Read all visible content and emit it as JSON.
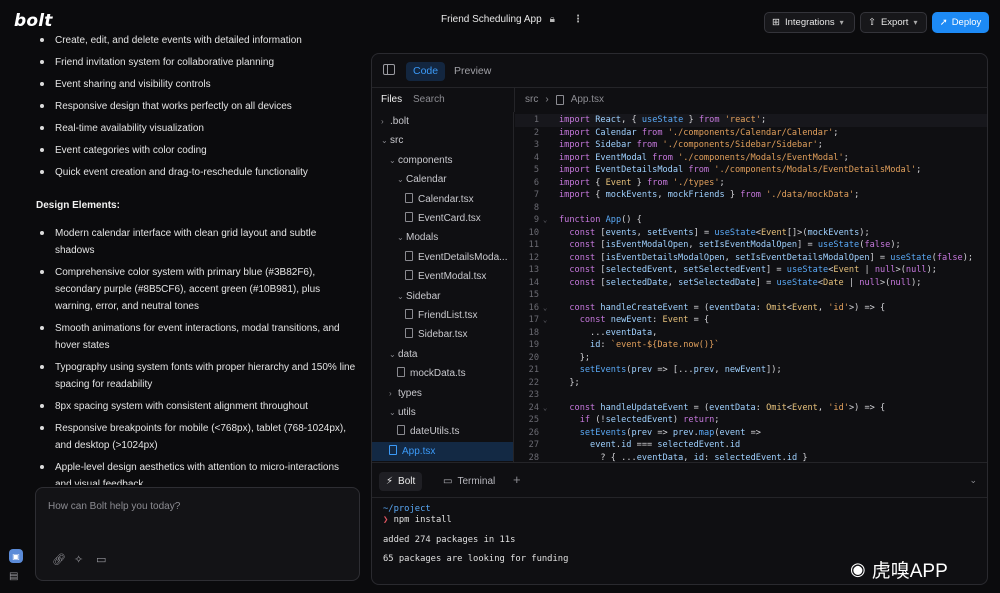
{
  "header": {
    "logo": "bolt",
    "project_title": "Friend Scheduling App",
    "integrations_label": "Integrations",
    "export_label": "Export",
    "deploy_label": "Deploy"
  },
  "chat": {
    "features_partial": [
      "Create, edit, and delete events with detailed information",
      "Friend invitation system for collaborative planning",
      "Event sharing and visibility controls",
      "Responsive design that works perfectly on all devices",
      "Real-time availability visualization",
      "Event categories with color coding",
      "Quick event creation and drag-to-reschedule functionality"
    ],
    "design_heading": "Design Elements:",
    "design_items": [
      "Modern calendar interface with clean grid layout and subtle shadows",
      "Comprehensive color system with primary blue (#3B82F6), secondary purple (#8B5CF6), accent green (#10B981), plus warning, error, and neutral tones",
      "Smooth animations for event interactions, modal transitions, and hover states",
      "Typography using system fonts with proper hierarchy and 150% line spacing for readability",
      "8px spacing system with consistent alignment throughout",
      "Responsive breakpoints for mobile (<768px), tablet (768-1024px), and desktop (>1024px)",
      "Apple-level design aesthetics with attention to micro-interactions and visual feedback"
    ],
    "input_placeholder": "How can Bolt help you today?"
  },
  "workbench": {
    "tabs": {
      "code": "Code",
      "preview": "Preview"
    },
    "files_label": "Files",
    "search_label": "Search",
    "tree": [
      {
        "label": ".bolt",
        "type": "folder",
        "depth": 0,
        "open": false
      },
      {
        "label": "src",
        "type": "folder",
        "depth": 0,
        "open": true
      },
      {
        "label": "components",
        "type": "folder",
        "depth": 1,
        "open": true
      },
      {
        "label": "Calendar",
        "type": "folder",
        "depth": 2,
        "open": true
      },
      {
        "label": "Calendar.tsx",
        "type": "file",
        "depth": 3
      },
      {
        "label": "EventCard.tsx",
        "type": "file",
        "depth": 3
      },
      {
        "label": "Modals",
        "type": "folder",
        "depth": 2,
        "open": true
      },
      {
        "label": "EventDetailsModa...",
        "type": "file",
        "depth": 3
      },
      {
        "label": "EventModal.tsx",
        "type": "file",
        "depth": 3
      },
      {
        "label": "Sidebar",
        "type": "folder",
        "depth": 2,
        "open": true
      },
      {
        "label": "FriendList.tsx",
        "type": "file",
        "depth": 3
      },
      {
        "label": "Sidebar.tsx",
        "type": "file",
        "depth": 3
      },
      {
        "label": "data",
        "type": "folder",
        "depth": 1,
        "open": true
      },
      {
        "label": "mockData.ts",
        "type": "file",
        "depth": 2
      },
      {
        "label": "types",
        "type": "folder",
        "depth": 1,
        "open": false
      },
      {
        "label": "utils",
        "type": "folder",
        "depth": 1,
        "open": true
      },
      {
        "label": "dateUtils.ts",
        "type": "file",
        "depth": 2
      },
      {
        "label": "App.tsx",
        "type": "file",
        "depth": 1,
        "active": true
      }
    ],
    "breadcrumb": {
      "folder": "src",
      "file": "App.tsx"
    },
    "code_lines": [
      {
        "n": "1",
        "t": "import React, { useState } from 'react';"
      },
      {
        "n": "2",
        "t": "import Calendar from './components/Calendar/Calendar';"
      },
      {
        "n": "3",
        "t": "import Sidebar from './components/Sidebar/Sidebar';"
      },
      {
        "n": "4",
        "t": "import EventModal from './components/Modals/EventModal';"
      },
      {
        "n": "5",
        "t": "import EventDetailsModal from './components/Modals/EventDetailsModal';"
      },
      {
        "n": "6",
        "t": "import { Event } from './types';"
      },
      {
        "n": "7",
        "t": "import { mockEvents, mockFriends } from './data/mockData';"
      },
      {
        "n": "8",
        "t": ""
      },
      {
        "n": "9",
        "t": "function App() {"
      },
      {
        "n": "10",
        "t": "  const [events, setEvents] = useState<Event[]>(mockEvents);"
      },
      {
        "n": "11",
        "t": "  const [isEventModalOpen, setIsEventModalOpen] = useState(false);"
      },
      {
        "n": "12",
        "t": "  const [isEventDetailsModalOpen, setIsEventDetailsModalOpen] = useState(false);"
      },
      {
        "n": "13",
        "t": "  const [selectedEvent, setSelectedEvent] = useState<Event | null>(null);"
      },
      {
        "n": "14",
        "t": "  const [selectedDate, setSelectedDate] = useState<Date | null>(null);"
      },
      {
        "n": "15",
        "t": ""
      },
      {
        "n": "16",
        "t": "  const handleCreateEvent = (eventData: Omit<Event, 'id'>) => {"
      },
      {
        "n": "17",
        "t": "    const newEvent: Event = {"
      },
      {
        "n": "18",
        "t": "      ...eventData,"
      },
      {
        "n": "19",
        "t": "      id: `event-${Date.now()}`"
      },
      {
        "n": "20",
        "t": "    };"
      },
      {
        "n": "21",
        "t": "    setEvents(prev => [...prev, newEvent]);"
      },
      {
        "n": "22",
        "t": "  };"
      },
      {
        "n": "23",
        "t": ""
      },
      {
        "n": "24",
        "t": "  const handleUpdateEvent = (eventData: Omit<Event, 'id'>) => {"
      },
      {
        "n": "25",
        "t": "    if (!selectedEvent) return;"
      },
      {
        "n": "26",
        "t": "    setEvents(prev => prev.map(event =>"
      },
      {
        "n": "27",
        "t": "      event.id === selectedEvent.id"
      },
      {
        "n": "28",
        "t": "        ? { ...eventData, id: selectedEvent.id }"
      }
    ],
    "fold_lines": [
      "9",
      "16",
      "17",
      "24"
    ],
    "terminal_tabs": {
      "bolt": "Bolt",
      "terminal": "Terminal"
    },
    "terminal_lines": {
      "path": "~/project",
      "prompt": "❯",
      "command": "npm install",
      "out1": "added 274 packages in 11s",
      "out2": "65 packages are looking for funding"
    }
  },
  "watermark": "虎嗅APP",
  "colors": {
    "accent": "#1d8af5",
    "background": "#0b0b0d"
  }
}
